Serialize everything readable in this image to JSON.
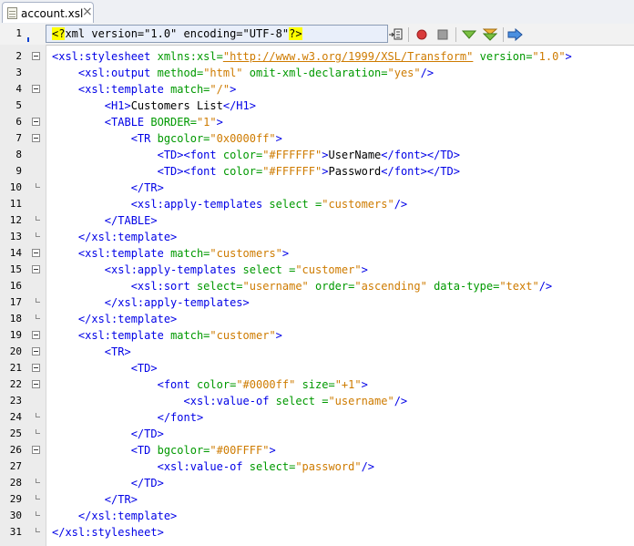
{
  "tab": {
    "title": "account.xsl",
    "close": "×"
  },
  "toolbar": {
    "icons": [
      "import-icon",
      "record-macro-icon",
      "stop-macro-icon",
      "next-error-icon",
      "next-bookmark-icon",
      "run-xslt-icon"
    ]
  },
  "lines": [
    {
      "n": "1",
      "tokens": [
        {
          "t": "pi",
          "v": "<?"
        },
        {
          "t": "plain",
          "v": "xml version=\"1.0\" encoding=\"UTF-8\""
        },
        {
          "t": "pi",
          "v": "?>"
        }
      ]
    },
    {
      "n": "2",
      "tokens": [
        {
          "t": "tag",
          "v": "<xsl:stylesheet "
        },
        {
          "t": "attr",
          "v": "xmlns:xsl="
        },
        {
          "t": "url",
          "v": "\"http://www.w3.org/1999/XSL/Transform\""
        },
        {
          "t": "attr",
          "v": " version="
        },
        {
          "t": "val",
          "v": "\"1.0\""
        },
        {
          "t": "tag",
          "v": ">"
        }
      ]
    },
    {
      "n": "3",
      "indent": "    ",
      "tokens": [
        {
          "t": "tag",
          "v": "<xsl:output "
        },
        {
          "t": "attr",
          "v": "method="
        },
        {
          "t": "val",
          "v": "\"html\""
        },
        {
          "t": "attr",
          "v": " omit-xml-declaration="
        },
        {
          "t": "val",
          "v": "\"yes\""
        },
        {
          "t": "tag",
          "v": "/>"
        }
      ]
    },
    {
      "n": "4",
      "indent": "    ",
      "tokens": [
        {
          "t": "tag",
          "v": "<xsl:template "
        },
        {
          "t": "attr",
          "v": "match="
        },
        {
          "t": "val",
          "v": "\"/\""
        },
        {
          "t": "tag",
          "v": ">"
        }
      ]
    },
    {
      "n": "5",
      "indent": "        ",
      "tokens": [
        {
          "t": "tag",
          "v": "<H1>"
        },
        {
          "t": "text",
          "v": "Customers List"
        },
        {
          "t": "tag",
          "v": "</H1>"
        }
      ]
    },
    {
      "n": "6",
      "indent": "        ",
      "tokens": [
        {
          "t": "tag",
          "v": "<TABLE "
        },
        {
          "t": "attr",
          "v": "BORDER="
        },
        {
          "t": "val",
          "v": "\"1\""
        },
        {
          "t": "tag",
          "v": ">"
        }
      ]
    },
    {
      "n": "7",
      "indent": "            ",
      "tokens": [
        {
          "t": "tag",
          "v": "<TR "
        },
        {
          "t": "attr",
          "v": "bgcolor="
        },
        {
          "t": "val",
          "v": "\"0x0000ff\""
        },
        {
          "t": "tag",
          "v": ">"
        }
      ]
    },
    {
      "n": "8",
      "indent": "                ",
      "tokens": [
        {
          "t": "tag",
          "v": "<TD><font "
        },
        {
          "t": "attr",
          "v": "color="
        },
        {
          "t": "val",
          "v": "\"#FFFFFF\""
        },
        {
          "t": "tag",
          "v": ">"
        },
        {
          "t": "text",
          "v": "UserName"
        },
        {
          "t": "tag",
          "v": "</font></TD>"
        }
      ]
    },
    {
      "n": "9",
      "indent": "                ",
      "tokens": [
        {
          "t": "tag",
          "v": "<TD><font "
        },
        {
          "t": "attr",
          "v": "color="
        },
        {
          "t": "val",
          "v": "\"#FFFFFF\""
        },
        {
          "t": "tag",
          "v": ">"
        },
        {
          "t": "text",
          "v": "Password"
        },
        {
          "t": "tag",
          "v": "</font></TD>"
        }
      ]
    },
    {
      "n": "10",
      "indent": "            ",
      "tokens": [
        {
          "t": "tag",
          "v": "</TR>"
        }
      ]
    },
    {
      "n": "11",
      "indent": "            ",
      "tokens": [
        {
          "t": "tag",
          "v": "<xsl:apply-templates "
        },
        {
          "t": "attr",
          "v": "select ="
        },
        {
          "t": "val",
          "v": "\"customers\""
        },
        {
          "t": "tag",
          "v": "/>"
        }
      ]
    },
    {
      "n": "12",
      "indent": "        ",
      "tokens": [
        {
          "t": "tag",
          "v": "</TABLE>"
        }
      ]
    },
    {
      "n": "13",
      "indent": "    ",
      "tokens": [
        {
          "t": "tag",
          "v": "</xsl:template>"
        }
      ]
    },
    {
      "n": "14",
      "indent": "    ",
      "tokens": [
        {
          "t": "tag",
          "v": "<xsl:template "
        },
        {
          "t": "attr",
          "v": "match="
        },
        {
          "t": "val",
          "v": "\"customers\""
        },
        {
          "t": "tag",
          "v": ">"
        }
      ]
    },
    {
      "n": "15",
      "indent": "        ",
      "tokens": [
        {
          "t": "tag",
          "v": "<xsl:apply-templates "
        },
        {
          "t": "attr",
          "v": "select ="
        },
        {
          "t": "val",
          "v": "\"customer\""
        },
        {
          "t": "tag",
          "v": ">"
        }
      ]
    },
    {
      "n": "16",
      "indent": "            ",
      "tokens": [
        {
          "t": "tag",
          "v": "<xsl:sort "
        },
        {
          "t": "attr",
          "v": "select="
        },
        {
          "t": "val",
          "v": "\"username\""
        },
        {
          "t": "attr",
          "v": " order="
        },
        {
          "t": "val",
          "v": "\"ascending\""
        },
        {
          "t": "attr",
          "v": " data-type="
        },
        {
          "t": "val",
          "v": "\"text\""
        },
        {
          "t": "tag",
          "v": "/>"
        }
      ]
    },
    {
      "n": "17",
      "indent": "        ",
      "tokens": [
        {
          "t": "tag",
          "v": "</xsl:apply-templates>"
        }
      ]
    },
    {
      "n": "18",
      "indent": "    ",
      "tokens": [
        {
          "t": "tag",
          "v": "</xsl:template>"
        }
      ]
    },
    {
      "n": "19",
      "indent": "    ",
      "tokens": [
        {
          "t": "tag",
          "v": "<xsl:template "
        },
        {
          "t": "attr",
          "v": "match="
        },
        {
          "t": "val",
          "v": "\"customer\""
        },
        {
          "t": "tag",
          "v": ">"
        }
      ]
    },
    {
      "n": "20",
      "indent": "        ",
      "tokens": [
        {
          "t": "tag",
          "v": "<TR>"
        }
      ]
    },
    {
      "n": "21",
      "indent": "            ",
      "tokens": [
        {
          "t": "tag",
          "v": "<TD>"
        }
      ]
    },
    {
      "n": "22",
      "indent": "                ",
      "tokens": [
        {
          "t": "tag",
          "v": "<font "
        },
        {
          "t": "attr",
          "v": "color="
        },
        {
          "t": "val",
          "v": "\"#0000ff\""
        },
        {
          "t": "attr",
          "v": " size="
        },
        {
          "t": "val",
          "v": "\"+1\""
        },
        {
          "t": "tag",
          "v": ">"
        }
      ]
    },
    {
      "n": "23",
      "indent": "                    ",
      "tokens": [
        {
          "t": "tag",
          "v": "<xsl:value-of "
        },
        {
          "t": "attr",
          "v": "select ="
        },
        {
          "t": "val",
          "v": "\"username\""
        },
        {
          "t": "tag",
          "v": "/>"
        }
      ]
    },
    {
      "n": "24",
      "indent": "                ",
      "tokens": [
        {
          "t": "tag",
          "v": "</font>"
        }
      ]
    },
    {
      "n": "25",
      "indent": "            ",
      "tokens": [
        {
          "t": "tag",
          "v": "</TD>"
        }
      ]
    },
    {
      "n": "26",
      "indent": "            ",
      "tokens": [
        {
          "t": "tag",
          "v": "<TD "
        },
        {
          "t": "attr",
          "v": "bgcolor="
        },
        {
          "t": "val",
          "v": "\"#00FFFF\""
        },
        {
          "t": "tag",
          "v": ">"
        }
      ]
    },
    {
      "n": "27",
      "indent": "                ",
      "tokens": [
        {
          "t": "tag",
          "v": "<xsl:value-of "
        },
        {
          "t": "attr",
          "v": "select="
        },
        {
          "t": "val",
          "v": "\"password\""
        },
        {
          "t": "tag",
          "v": "/>"
        }
      ]
    },
    {
      "n": "28",
      "indent": "            ",
      "tokens": [
        {
          "t": "tag",
          "v": "</TD>"
        }
      ]
    },
    {
      "n": "29",
      "indent": "        ",
      "tokens": [
        {
          "t": "tag",
          "v": "</TR>"
        }
      ]
    },
    {
      "n": "30",
      "indent": "    ",
      "tokens": [
        {
          "t": "tag",
          "v": "</xsl:template>"
        }
      ]
    },
    {
      "n": "31",
      "tokens": [
        {
          "t": "tag",
          "v": "</xsl:stylesheet>"
        }
      ]
    }
  ],
  "colors": {
    "tag": "#0000e6",
    "attr": "#009900",
    "value": "#ce7b00",
    "highlight": "#ffff00"
  }
}
